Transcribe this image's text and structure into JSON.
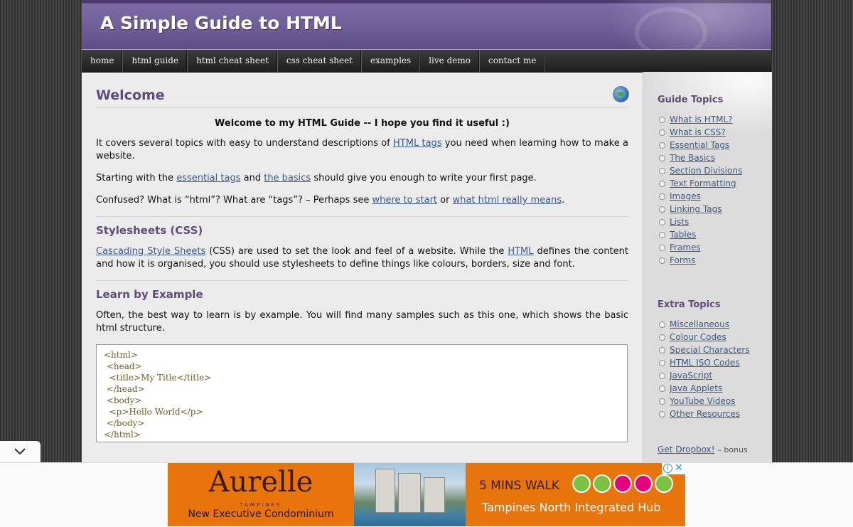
{
  "site": {
    "title": "A Simple Guide to HTML"
  },
  "nav": [
    "home",
    "html guide",
    "html cheat sheet",
    "css cheat sheet",
    "examples",
    "live demo",
    "contact me"
  ],
  "main": {
    "heading": "Welcome",
    "lead": "Welcome to my HTML Guide -- I hope you find it useful :)",
    "p1": {
      "a": "It covers several topics with easy to understand descriptions of ",
      "link": "HTML tags",
      "b": " you need when learning how to make a website."
    },
    "p2": {
      "a": "Starting with the ",
      "link1": "essential tags",
      "b": " and ",
      "link2": "the basics",
      "c": " should give you enough to write your first page."
    },
    "p3": {
      "a": "Confused? What is “html”? What are “tags”? – Perhaps see ",
      "link1": "where to start",
      "b": " or ",
      "link2": "what html really means",
      "c": "."
    },
    "css_heading": "Stylesheets (CSS)",
    "css_p": {
      "link1": "Cascading Style Sheets",
      "a": " (CSS) are used to set the look and feel of a website. While the ",
      "link2": "HTML",
      "b": " defines the content and how it is organised, you should use stylesheets to define things like colours, borders, size and font."
    },
    "example_heading": "Learn by Example",
    "example_p": "Often, the best way to learn is by example. You will find many samples such as this one, which shows the basic html structure.",
    "code": [
      "<html>",
      " <head>",
      "  <title>My Title</title>",
      " </head>",
      " <body>",
      "  <p>Hello World</p>",
      " </body>",
      "</html>"
    ]
  },
  "sidebar": {
    "guide_heading": "Guide Topics",
    "guide_links": [
      "What is HTML?",
      "What is CSS?",
      "Essential Tags",
      "The Basics",
      "Section Divisions",
      "Text Formatting",
      "Images",
      "Linking Tags",
      "Lists",
      "Tables",
      "Frames",
      "Forms"
    ],
    "extra_heading": "Extra Topics",
    "extra_links": [
      "Miscellaneous",
      "Colour Codes",
      "Special Characters",
      "HTML ISO Codes",
      "JavaScript",
      "Java Applets",
      "YouTube Videos",
      "Other Resources"
    ],
    "dropbox_link": "Get Dropbox!",
    "dropbox_note": "– bonus"
  },
  "ad": {
    "brand": "Aurelle",
    "brand_sub": "TAMPINES",
    "tagline": "New Executive Condominium",
    "walk": "5 MINS WALK",
    "hub": "Tampines North Integrated Hub",
    "icon_colors": [
      "#7cc242",
      "#7cc242",
      "#e6007e",
      "#e6007e",
      "#7cc242"
    ],
    "close_info": "i",
    "close_x": "✕"
  },
  "colors": {
    "accent": "#5b4e7b",
    "link": "#3a5a8c",
    "ad_orange": "#e8740c"
  }
}
